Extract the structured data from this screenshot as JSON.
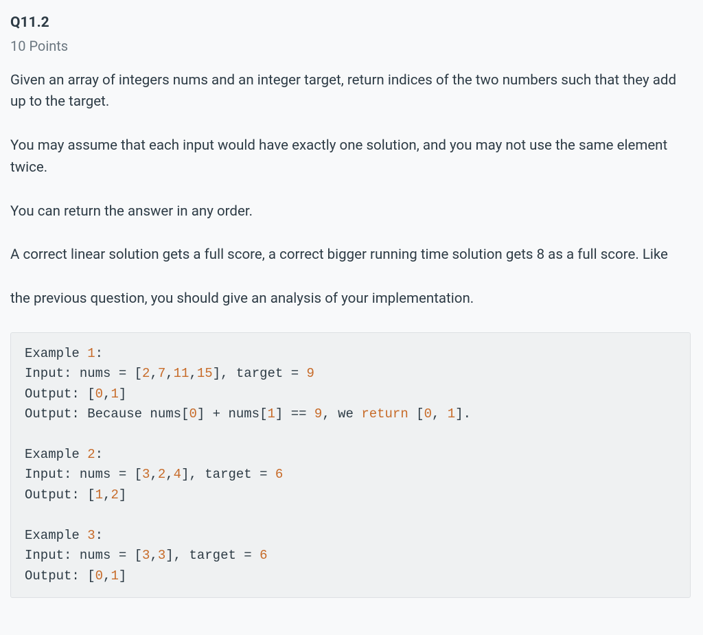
{
  "header": {
    "number": "Q11.2",
    "points": "10 Points"
  },
  "paragraphs": {
    "p1": "Given an array of integers nums and an integer target, return indices of the two numbers such that they add up to the target.",
    "p2": "You may assume that each input would have exactly one solution, and you may not use the same element twice.",
    "p3": "You can return the answer in any order.",
    "p4": "A correct linear solution gets a full score, a correct bigger running time solution gets 8 as a full score. Like",
    "p5": "the previous question, you should give an analysis of your implementation."
  },
  "code": {
    "tokens": [
      {
        "t": "Example "
      },
      {
        "t": "1",
        "c": "num"
      },
      {
        "t": ":\n"
      },
      {
        "t": "Input: nums = ["
      },
      {
        "t": "2",
        "c": "num"
      },
      {
        "t": ","
      },
      {
        "t": "7",
        "c": "num"
      },
      {
        "t": ","
      },
      {
        "t": "11",
        "c": "num"
      },
      {
        "t": ","
      },
      {
        "t": "15",
        "c": "num"
      },
      {
        "t": "], target = "
      },
      {
        "t": "9",
        "c": "num"
      },
      {
        "t": "\n"
      },
      {
        "t": "Output: ["
      },
      {
        "t": "0",
        "c": "num"
      },
      {
        "t": ","
      },
      {
        "t": "1",
        "c": "num"
      },
      {
        "t": "]\n"
      },
      {
        "t": "Output: Because nums["
      },
      {
        "t": "0",
        "c": "num"
      },
      {
        "t": "] + nums["
      },
      {
        "t": "1",
        "c": "num"
      },
      {
        "t": "] == "
      },
      {
        "t": "9",
        "c": "num"
      },
      {
        "t": ", we "
      },
      {
        "t": "return",
        "c": "kw"
      },
      {
        "t": " ["
      },
      {
        "t": "0",
        "c": "num"
      },
      {
        "t": ", "
      },
      {
        "t": "1",
        "c": "num"
      },
      {
        "t": "].\n"
      },
      {
        "t": "\n"
      },
      {
        "t": "Example "
      },
      {
        "t": "2",
        "c": "num"
      },
      {
        "t": ":\n"
      },
      {
        "t": "Input: nums = ["
      },
      {
        "t": "3",
        "c": "num"
      },
      {
        "t": ","
      },
      {
        "t": "2",
        "c": "num"
      },
      {
        "t": ","
      },
      {
        "t": "4",
        "c": "num"
      },
      {
        "t": "], target = "
      },
      {
        "t": "6",
        "c": "num"
      },
      {
        "t": "\n"
      },
      {
        "t": "Output: ["
      },
      {
        "t": "1",
        "c": "num"
      },
      {
        "t": ","
      },
      {
        "t": "2",
        "c": "num"
      },
      {
        "t": "]\n"
      },
      {
        "t": "\n"
      },
      {
        "t": "Example "
      },
      {
        "t": "3",
        "c": "num"
      },
      {
        "t": ":\n"
      },
      {
        "t": "Input: nums = ["
      },
      {
        "t": "3",
        "c": "num"
      },
      {
        "t": ","
      },
      {
        "t": "3",
        "c": "num"
      },
      {
        "t": "], target = "
      },
      {
        "t": "6",
        "c": "num"
      },
      {
        "t": "\n"
      },
      {
        "t": "Output: ["
      },
      {
        "t": "0",
        "c": "num"
      },
      {
        "t": ","
      },
      {
        "t": "1",
        "c": "num"
      },
      {
        "t": "]"
      }
    ]
  }
}
